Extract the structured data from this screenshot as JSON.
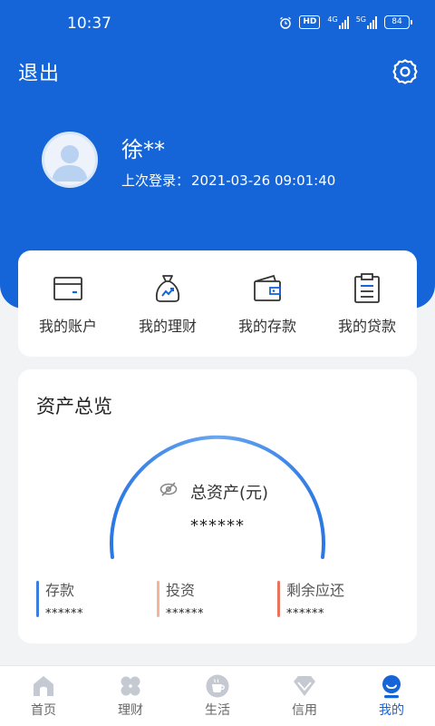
{
  "status_bar": {
    "time": "10:37",
    "hd": "HD",
    "signal1": "4G",
    "signal2": "5G",
    "battery": "84"
  },
  "header": {
    "logout_label": "退出"
  },
  "profile": {
    "username": "徐**",
    "last_login_label": "上次登录：",
    "last_login_time": "2021-03-26 09:01:40"
  },
  "quick_actions": [
    {
      "label": "我的账户",
      "icon": "card-icon"
    },
    {
      "label": "我的理财",
      "icon": "money-bag-icon"
    },
    {
      "label": "我的存款",
      "icon": "wallet-icon"
    },
    {
      "label": "我的贷款",
      "icon": "clipboard-icon"
    }
  ],
  "assets": {
    "title": "资产总览",
    "total_label": "总资产(元)",
    "total_value": "******",
    "stats": [
      {
        "label": "存款",
        "value": "******",
        "color": "#3a7fe0"
      },
      {
        "label": "投资",
        "value": "******",
        "color": "#f3b49a"
      },
      {
        "label": "剩余应还",
        "value": "******",
        "color": "#e8745e"
      }
    ]
  },
  "tabbar": {
    "active": "我的",
    "items": [
      {
        "label": "首页",
        "icon": "home-icon"
      },
      {
        "label": "理财",
        "icon": "clover-icon"
      },
      {
        "label": "生活",
        "icon": "coffee-cup-icon"
      },
      {
        "label": "信用",
        "icon": "diamond-icon"
      },
      {
        "label": "我的",
        "icon": "user-icon"
      }
    ]
  },
  "colors": {
    "primary": "#1565d8",
    "inactive_icon": "#c4c9d2"
  }
}
